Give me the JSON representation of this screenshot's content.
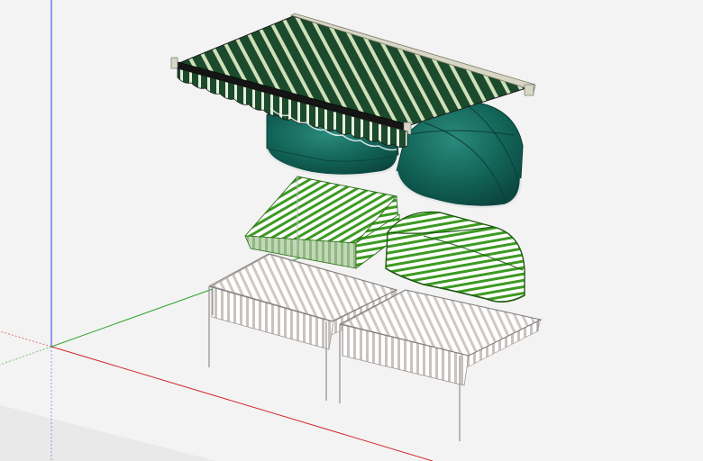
{
  "viewport": {
    "background": "#f3f3f3",
    "ground_shade": "#ebebeb",
    "axis_colors": {
      "x": "#d22a2a",
      "y": "#2aa52a",
      "z": "#3a3aee"
    }
  },
  "model": {
    "palette": {
      "dark_green": "#1c4a2c",
      "stripe_light": "#cfe0b8",
      "teal": "#0f5a52",
      "teal_light": "#1e7a6e",
      "bright_green": "#3d9a22",
      "white_stripe": "#ffffff",
      "grey_stripe": "#cfc8c4",
      "frame_white": "#f7f7f7",
      "outline": "#2b2b2b"
    },
    "objects": [
      {
        "name": "retractable-awning",
        "style": "striped dark green / cream"
      },
      {
        "name": "dome-awning-round",
        "style": "teal canopy"
      },
      {
        "name": "dome-awning-quarter",
        "style": "teal canopy"
      },
      {
        "name": "dutch-awning",
        "style": "green / white stripes"
      },
      {
        "name": "elongated-dome-awning",
        "style": "green / white stripes"
      },
      {
        "name": "canopy-stand-left",
        "style": "grey / white stripes"
      },
      {
        "name": "canopy-stand-right",
        "style": "grey / white stripes"
      }
    ]
  }
}
